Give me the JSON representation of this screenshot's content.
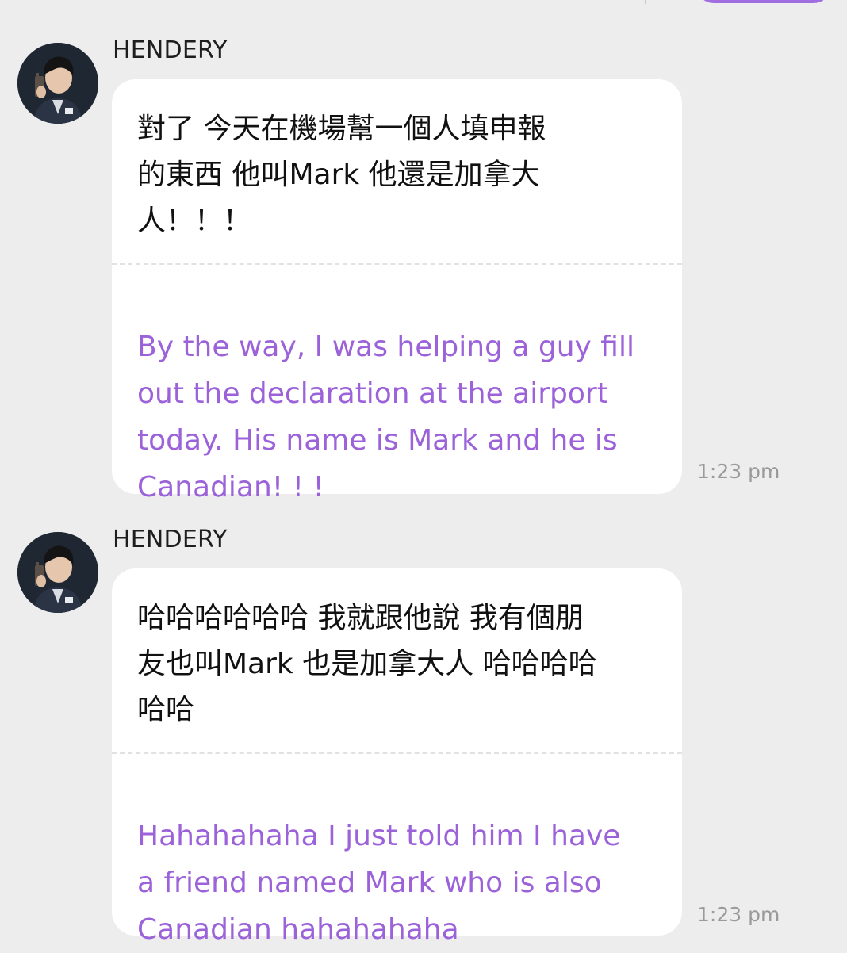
{
  "colors": {
    "background": "#ededed",
    "bubble": "#ffffff",
    "translation_text": "#9b62d9",
    "original_text": "#111111",
    "timestamp": "#9a9a9a",
    "own_bubble_accent": "#a06ee0"
  },
  "messages": [
    {
      "sender": "HENDERY",
      "avatar_icon": "user-avatar-icon",
      "original": "對了 今天在機場幫一個人填申報\n的東西 他叫Mark 他還是加拿大\n人！！！",
      "translation": "By the way, I was helping a guy fill\nout the declaration at the airport\ntoday. His name is Mark and he is\nCanadian! ! !",
      "time": "1:23 pm"
    },
    {
      "sender": "HENDERY",
      "avatar_icon": "user-avatar-icon",
      "original": "哈哈哈哈哈哈 我就跟他說 我有個朋\n友也叫Mark 也是加拿大人 哈哈哈哈\n哈哈",
      "translation": "Hahahahaha I just told him I have\na friend named Mark who is also\nCanadian hahahahaha",
      "time": "1:23 pm"
    }
  ]
}
